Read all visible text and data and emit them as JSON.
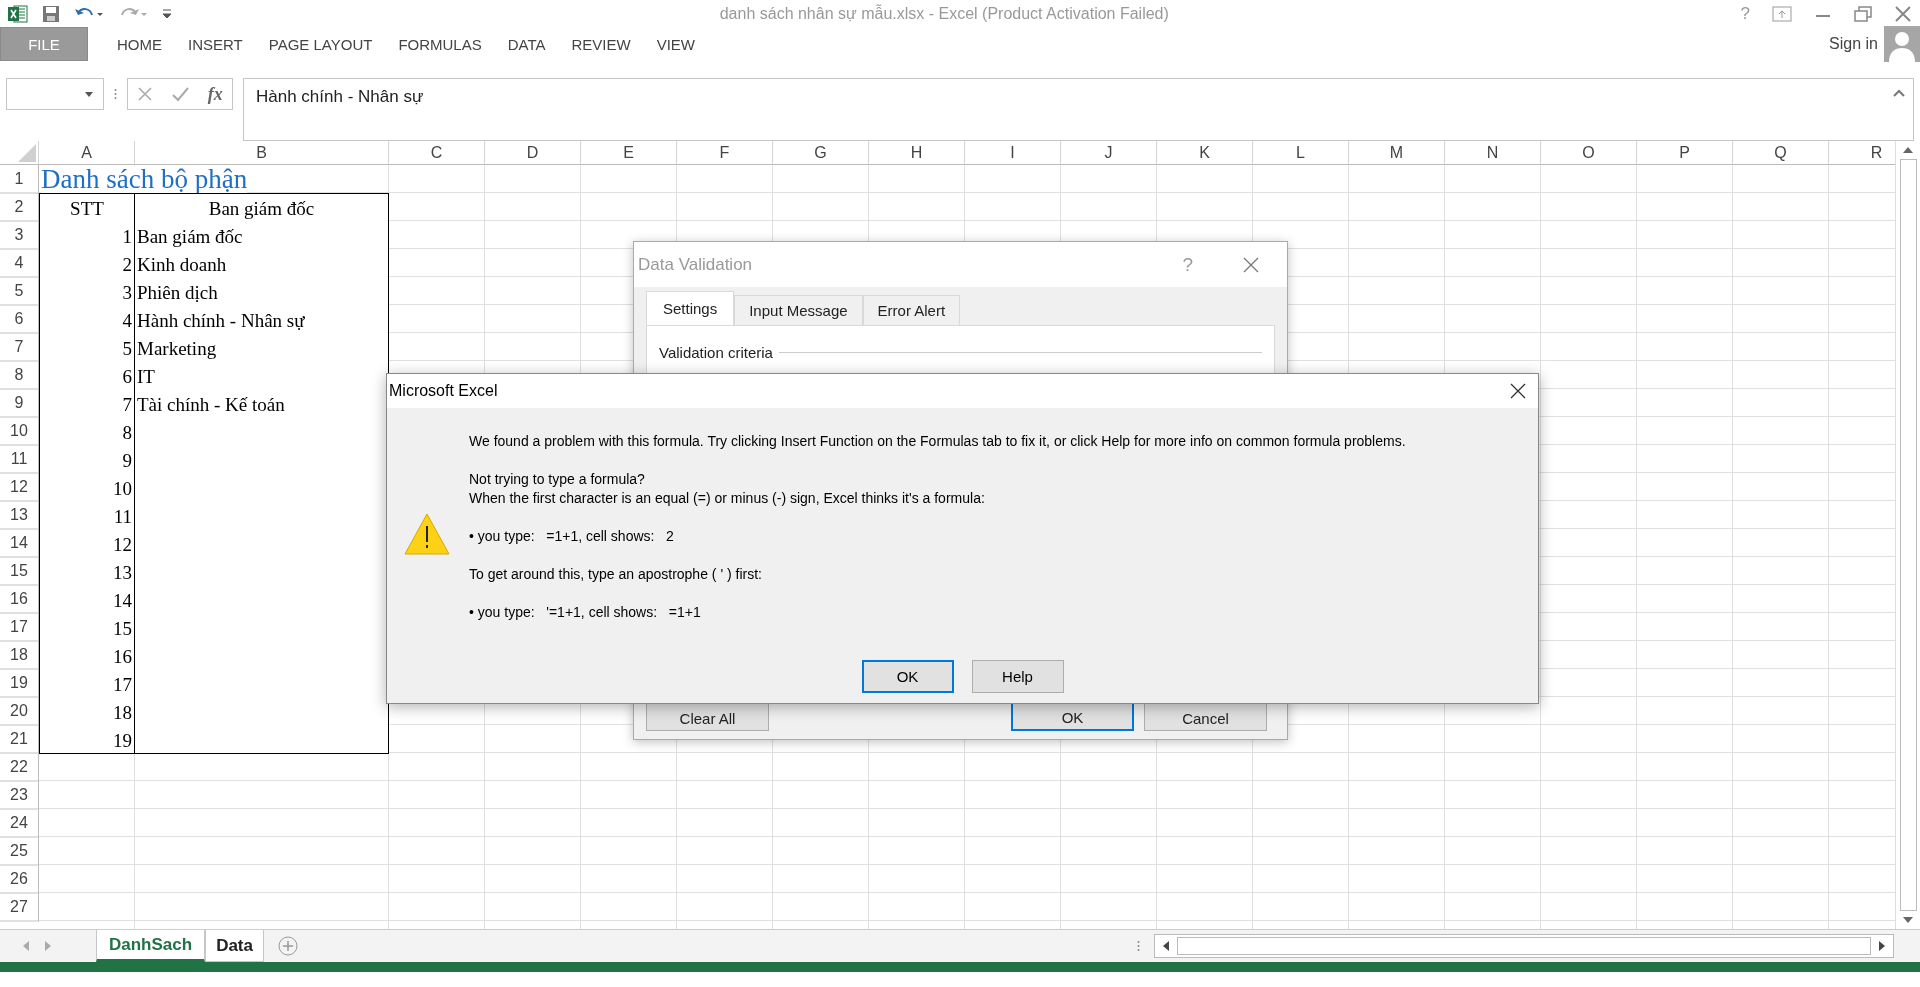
{
  "window": {
    "title": "danh sách nhân sự mẫu.xlsx - Excel (Product Activation Failed)",
    "help": "?"
  },
  "ribbon_tabs": [
    {
      "label": "FILE",
      "kind": "file",
      "selected": false
    },
    {
      "label": "HOME",
      "kind": "tab",
      "selected": false
    },
    {
      "label": "INSERT",
      "kind": "tab",
      "selected": false
    },
    {
      "label": "PAGE LAYOUT",
      "kind": "tab",
      "selected": false
    },
    {
      "label": "FORMULAS",
      "kind": "tab",
      "selected": false
    },
    {
      "label": "DATA",
      "kind": "tab",
      "selected": false
    },
    {
      "label": "REVIEW",
      "kind": "tab",
      "selected": false
    },
    {
      "label": "VIEW",
      "kind": "tab",
      "selected": false
    }
  ],
  "account": {
    "label": "Sign in"
  },
  "formula_bar": {
    "function_label": "fx",
    "value": "Hành chính - Nhân sự"
  },
  "sheet": {
    "columns": [
      "A",
      "B",
      "C",
      "D",
      "E",
      "F",
      "G",
      "H",
      "I",
      "J",
      "K",
      "L",
      "M",
      "N",
      "O",
      "P",
      "Q",
      "R"
    ],
    "rows": [
      {
        "header": "1",
        "kind": "title",
        "cells": [
          "Danh sách bộ phận"
        ]
      },
      {
        "header": "2",
        "kind": "heading",
        "cells": [
          "STT",
          "Ban giám đốc"
        ]
      },
      {
        "header": "3",
        "kind": "entry",
        "cells": [
          "1",
          "Ban giám đốc"
        ]
      },
      {
        "header": "4",
        "kind": "entry",
        "cells": [
          "2",
          "Kinh doanh"
        ]
      },
      {
        "header": "5",
        "kind": "entry",
        "cells": [
          "3",
          "Phiên dịch"
        ]
      },
      {
        "header": "6",
        "kind": "entry",
        "cells": [
          "4",
          "Hành chính - Nhân sự"
        ]
      },
      {
        "header": "7",
        "kind": "entry",
        "cells": [
          "5",
          "Marketing"
        ]
      },
      {
        "header": "8",
        "kind": "entry",
        "cells": [
          "6",
          "IT"
        ]
      },
      {
        "header": "9",
        "kind": "entry",
        "cells": [
          "7",
          "Tài chính - Kế toán"
        ]
      },
      {
        "header": "10",
        "kind": "entry",
        "cells": [
          "8"
        ]
      },
      {
        "header": "11",
        "kind": "entry",
        "cells": [
          "9"
        ]
      },
      {
        "header": "12",
        "kind": "entry",
        "cells": [
          "10"
        ]
      },
      {
        "header": "13",
        "kind": "entry",
        "cells": [
          "11"
        ]
      },
      {
        "header": "14",
        "kind": "entry",
        "cells": [
          "12"
        ]
      },
      {
        "header": "15",
        "kind": "entry",
        "cells": [
          "13"
        ]
      },
      {
        "header": "16",
        "kind": "entry",
        "cells": [
          "14"
        ]
      },
      {
        "header": "17",
        "kind": "entry",
        "cells": [
          "15"
        ]
      },
      {
        "header": "18",
        "kind": "entry",
        "cells": [
          "16"
        ]
      },
      {
        "header": "19",
        "kind": "entry",
        "cells": [
          "17"
        ]
      },
      {
        "header": "20",
        "kind": "entry",
        "cells": [
          "18"
        ]
      },
      {
        "header": "21",
        "kind": "entry",
        "cells": [
          "19"
        ]
      },
      {
        "header": "22",
        "kind": "blank"
      },
      {
        "header": "23",
        "kind": "blank"
      },
      {
        "header": "24",
        "kind": "blank"
      },
      {
        "header": "25",
        "kind": "blank"
      },
      {
        "header": "26",
        "kind": "blank"
      },
      {
        "header": "27",
        "kind": "blank"
      }
    ]
  },
  "sheet_tabs": [
    {
      "label": "DanhSach",
      "selected": true
    },
    {
      "label": "Data",
      "selected": false
    }
  ],
  "validation_dialog": {
    "title": "Data Validation",
    "help": "?",
    "tabs": [
      {
        "label": "Settings",
        "selected": true
      },
      {
        "label": "Input Message",
        "selected": false
      },
      {
        "label": "Error Alert",
        "selected": false
      }
    ],
    "section": "Validation criteria",
    "buttons": [
      {
        "label": "Clear All",
        "default": false
      },
      {
        "label": "OK",
        "default": true
      },
      {
        "label": "Cancel",
        "default": false
      }
    ]
  },
  "alert_dialog": {
    "title": "Microsoft Excel",
    "paragraphs": [
      [
        "We found a problem with this formula. Try clicking Insert Function on the Formulas tab to fix it, or click Help for more info on common formula problems."
      ],
      [
        "Not trying to type a formula?",
        "When the first character is an equal (=) or minus (-) sign, Excel thinks it's a formula:"
      ],
      [
        "• you type:   =1+1, cell shows:   2"
      ],
      [
        "To get around this, type an apostrophe ( ' ) first:"
      ],
      [
        "• you type:   '=1+1, cell shows:   =1+1"
      ]
    ],
    "buttons": [
      {
        "label": "OK",
        "default": true
      },
      {
        "label": "Help",
        "default": false
      }
    ]
  }
}
